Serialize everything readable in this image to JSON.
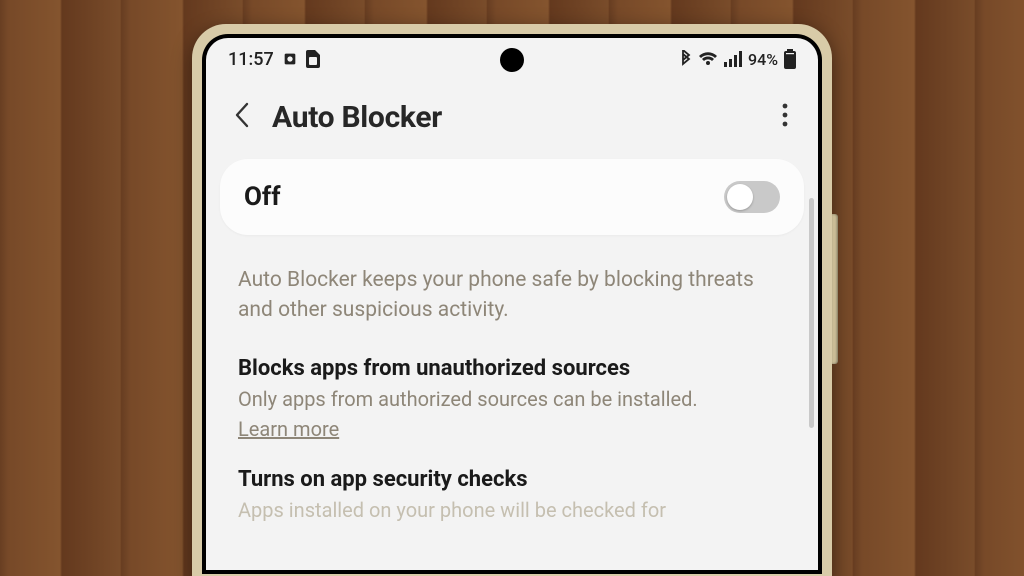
{
  "status": {
    "time": "11:57",
    "battery_text": "94%",
    "icons": {
      "alarm": "alarm-icon",
      "sim": "sim-icon",
      "bluetooth": "bluetooth-icon",
      "wifi": "wifi-icon",
      "signal": "signal-icon",
      "battery": "battery-icon"
    }
  },
  "header": {
    "title": "Auto Blocker"
  },
  "toggle": {
    "label": "Off",
    "state": "off"
  },
  "description": "Auto Blocker keeps your phone safe by blocking threats and other suspicious activity.",
  "sections": [
    {
      "title": "Blocks apps from unauthorized sources",
      "body": "Only apps from authorized sources can be installed.",
      "link": "Learn more"
    },
    {
      "title": "Turns on app security checks",
      "body_truncated": "Apps installed on your phone will be checked for"
    }
  ]
}
